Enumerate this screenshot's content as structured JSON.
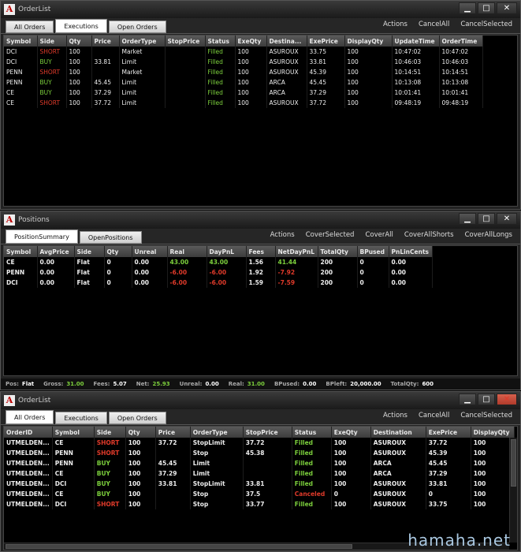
{
  "window1": {
    "title": "OrderList",
    "tabs": [
      "All Orders",
      "Executions",
      "Open Orders"
    ],
    "actions": [
      "Actions",
      "CancelAll",
      "CancelSelected"
    ],
    "columns": [
      "Symbol",
      "Side",
      "Qty",
      "Price",
      "OrderType",
      "StopPrice",
      "Status",
      "ExeQty",
      "Destina...",
      "ExePrice",
      "DisplayQty",
      "UpdateTime",
      "OrderTime"
    ],
    "rows": [
      [
        "DCI",
        "SHORT",
        "100",
        "",
        "Market",
        "",
        "Filled",
        "100",
        "ASUROUX",
        "33.75",
        "100",
        "10:47:02",
        "10:47:02"
      ],
      [
        "DCI",
        "BUY",
        "100",
        "33.81",
        "Limit",
        "",
        "Filled",
        "100",
        "ASUROUX",
        "33.81",
        "100",
        "10:46:03",
        "10:46:03"
      ],
      [
        "PENN",
        "SHORT",
        "100",
        "",
        "Market",
        "",
        "Filled",
        "100",
        "ASUROUX",
        "45.39",
        "100",
        "10:14:51",
        "10:14:51"
      ],
      [
        "PENN",
        "BUY",
        "100",
        "45.45",
        "Limit",
        "",
        "Filled",
        "100",
        "ARCA",
        "45.45",
        "100",
        "10:13:08",
        "10:13:08"
      ],
      [
        "CE",
        "BUY",
        "100",
        "37.29",
        "Limit",
        "",
        "Filled",
        "100",
        "ARCA",
        "37.29",
        "100",
        "10:01:41",
        "10:01:41"
      ],
      [
        "CE",
        "SHORT",
        "100",
        "37.72",
        "Limit",
        "",
        "Filled",
        "100",
        "ASUROUX",
        "37.72",
        "100",
        "09:48:19",
        "09:48:19"
      ]
    ]
  },
  "window2": {
    "title": "Positions",
    "tabs": [
      "PositionSummary",
      "OpenPositions"
    ],
    "actions": [
      "Actions",
      "CoverSelected",
      "CoverAll",
      "CoverAllShorts",
      "CoverAllLongs"
    ],
    "columns": [
      "Symbol",
      "AvgPrice",
      "Side",
      "Qty",
      "Unreal",
      "Real",
      "DayPnL",
      "Fees",
      "NetDayPnL",
      "TotalQty",
      "BPused",
      "PnLinCents"
    ],
    "rows": [
      [
        "CE",
        "0.00",
        "Flat",
        "0",
        "0.00",
        "43.00",
        "43.00",
        "1.56",
        "41.44",
        "200",
        "0",
        "0.00"
      ],
      [
        "PENN",
        "0.00",
        "Flat",
        "0",
        "0.00",
        "-6.00",
        "-6.00",
        "1.92",
        "-7.92",
        "200",
        "0",
        "0.00"
      ],
      [
        "DCI",
        "0.00",
        "Flat",
        "0",
        "0.00",
        "-6.00",
        "-6.00",
        "1.59",
        "-7.59",
        "200",
        "0",
        "0.00"
      ]
    ],
    "status": [
      {
        "label": "Pos:",
        "value": "Flat"
      },
      {
        "label": "Gross:",
        "value": "31.00"
      },
      {
        "label": "Fees:",
        "value": "5.07"
      },
      {
        "label": "Net:",
        "value": "25.93"
      },
      {
        "label": "Unreal:",
        "value": "0.00"
      },
      {
        "label": "Real:",
        "value": "31.00"
      },
      {
        "label": "BPused:",
        "value": "0.00"
      },
      {
        "label": "BPleft:",
        "value": "20,000.00"
      },
      {
        "label": "TotalQty:",
        "value": "600"
      }
    ]
  },
  "window3": {
    "title": "OrderList",
    "tabs": [
      "All Orders",
      "Executions",
      "Open Orders"
    ],
    "actions": [
      "Actions",
      "CancelAll",
      "CancelSelected"
    ],
    "columns": [
      "OrderID",
      "Symbol",
      "Side",
      "Qty",
      "Price",
      "OrderType",
      "StopPrice",
      "Status",
      "ExeQty",
      "Destination",
      "ExePrice",
      "DisplayQty"
    ],
    "rows": [
      [
        "UTMELDEN...",
        "CE",
        "SHORT",
        "100",
        "37.72",
        "StopLimit",
        "37.72",
        "Filled",
        "100",
        "ASUROUX",
        "37.72",
        "100"
      ],
      [
        "UTMELDEN...",
        "PENN",
        "SHORT",
        "100",
        "",
        "Stop",
        "45.38",
        "Filled",
        "100",
        "ASUROUX",
        "45.39",
        "100"
      ],
      [
        "UTMELDEN...",
        "PENN",
        "BUY",
        "100",
        "45.45",
        "Limit",
        "",
        "Filled",
        "100",
        "ARCA",
        "45.45",
        "100"
      ],
      [
        "UTMELDEN...",
        "CE",
        "BUY",
        "100",
        "37.29",
        "Limit",
        "",
        "Filled",
        "100",
        "ARCA",
        "37.29",
        "100"
      ],
      [
        "UTMELDEN...",
        "DCI",
        "BUY",
        "100",
        "33.81",
        "StopLimit",
        "33.81",
        "Filled",
        "100",
        "ASUROUX",
        "33.81",
        "100"
      ],
      [
        "UTMELDEN...",
        "CE",
        "BUY",
        "100",
        "",
        "Stop",
        "37.5",
        "Canceled",
        "0",
        "ASUROUX",
        "0",
        "100"
      ],
      [
        "UTMELDEN...",
        "DCI",
        "SHORT",
        "100",
        "",
        "Stop",
        "33.77",
        "Filled",
        "100",
        "ASUROUX",
        "33.75",
        "100"
      ]
    ]
  },
  "watermark": "hamaha.net",
  "colors": {
    "short": "#e03a2a",
    "buy": "#7ccf3c",
    "filled": "#7ccf3c",
    "canceled": "#e03a2a",
    "close_red": "#c8493a"
  }
}
